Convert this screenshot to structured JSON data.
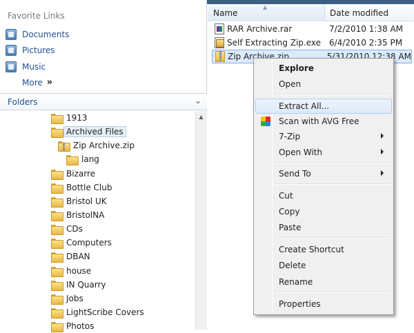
{
  "favorites": {
    "header": "Favorite Links",
    "items": [
      {
        "label": "Documents",
        "icon": "documents-icon"
      },
      {
        "label": "Pictures",
        "icon": "pictures-icon"
      },
      {
        "label": "Music",
        "icon": "music-icon"
      }
    ],
    "more_label": "More",
    "more_chevron": "»"
  },
  "folders": {
    "title": "Folders",
    "collapse_glyph": "⌄",
    "tree": [
      {
        "label": "1913"
      },
      {
        "label": "Archived Files"
      },
      {
        "label": "Zip Archive.zip"
      },
      {
        "label": "lang"
      },
      {
        "label": "Bizarre"
      },
      {
        "label": "Bottle Club"
      },
      {
        "label": "Bristol UK"
      },
      {
        "label": "BristolNA"
      },
      {
        "label": "CDs"
      },
      {
        "label": "Computers"
      },
      {
        "label": "DBAN"
      },
      {
        "label": "house"
      },
      {
        "label": "IN Quarry"
      },
      {
        "label": "Jobs"
      },
      {
        "label": "LightScribe Covers"
      },
      {
        "label": "Photos"
      }
    ]
  },
  "file_list": {
    "columns": {
      "name": "Name",
      "date": "Date modified"
    },
    "rows": [
      {
        "name": "RAR Archive.rar",
        "date": "7/2/2010 1:38 AM",
        "icon": "rar-icon"
      },
      {
        "name": "Self Extracting Zip.exe",
        "date": "6/4/2010 2:35 PM",
        "icon": "exe-icon"
      },
      {
        "name": "Zip Archive.zip",
        "date": "5/31/2010 12:38 AM",
        "icon": "zip-icon"
      }
    ]
  },
  "context_menu": {
    "items": [
      {
        "label": "Explore"
      },
      {
        "label": "Open"
      },
      {
        "label": "Extract All..."
      },
      {
        "label": "Scan with AVG Free"
      },
      {
        "label": "7-Zip"
      },
      {
        "label": "Open With"
      },
      {
        "label": "Send To"
      },
      {
        "label": "Cut"
      },
      {
        "label": "Copy"
      },
      {
        "label": "Paste"
      },
      {
        "label": "Create Shortcut"
      },
      {
        "label": "Delete"
      },
      {
        "label": "Rename"
      },
      {
        "label": "Properties"
      }
    ]
  },
  "colors": {
    "link_blue": "#1f4f8f",
    "selection": "#dcebfc",
    "menu_background": "#f0f0f0"
  }
}
